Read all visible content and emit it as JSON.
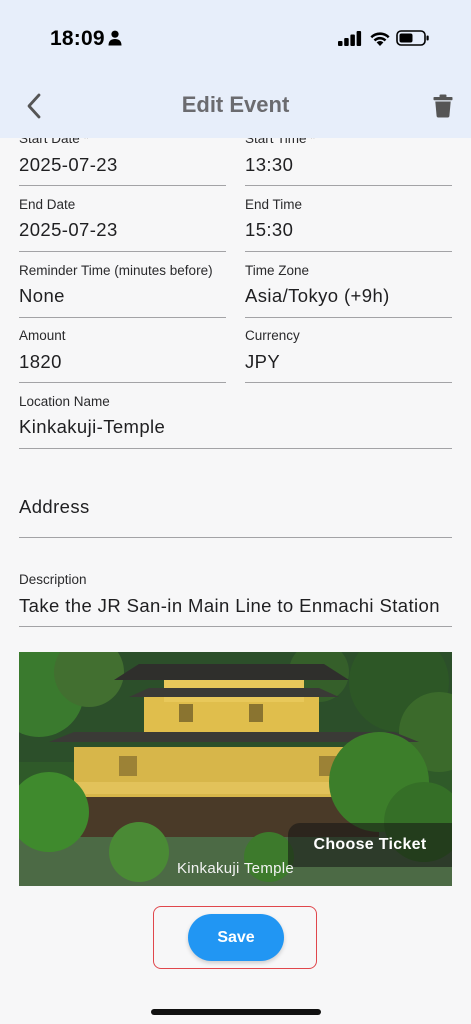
{
  "status_bar": {
    "time": "18:09"
  },
  "header": {
    "title": "Edit Event"
  },
  "fields": {
    "start_date": {
      "label": "Start Date *",
      "value": "2025-07-23"
    },
    "start_time": {
      "label": "Start Time *",
      "value": "13:30"
    },
    "end_date": {
      "label": "End Date",
      "value": "2025-07-23"
    },
    "end_time": {
      "label": "End Time",
      "value": "15:30"
    },
    "reminder": {
      "label": "Reminder Time (minutes before)",
      "value": "None"
    },
    "time_zone": {
      "label": "Time Zone",
      "value": "Asia/Tokyo (+9h)"
    },
    "amount": {
      "label": "Amount",
      "value": "1820"
    },
    "currency": {
      "label": "Currency",
      "value": "JPY"
    },
    "location_name": {
      "label": "Location Name",
      "value": "Kinkakuji-Temple"
    },
    "address": {
      "placeholder": "Address"
    },
    "description": {
      "label": "Description",
      "value": "Take the JR San-in Main Line to Enmachi Station"
    }
  },
  "photo": {
    "caption": "Kinkakuji Temple",
    "choose_ticket_label": "Choose Ticket"
  },
  "save_label": "Save",
  "colors": {
    "accent": "#2196f3",
    "header_bg": "#e7eefa",
    "highlight": "#e0474c"
  }
}
